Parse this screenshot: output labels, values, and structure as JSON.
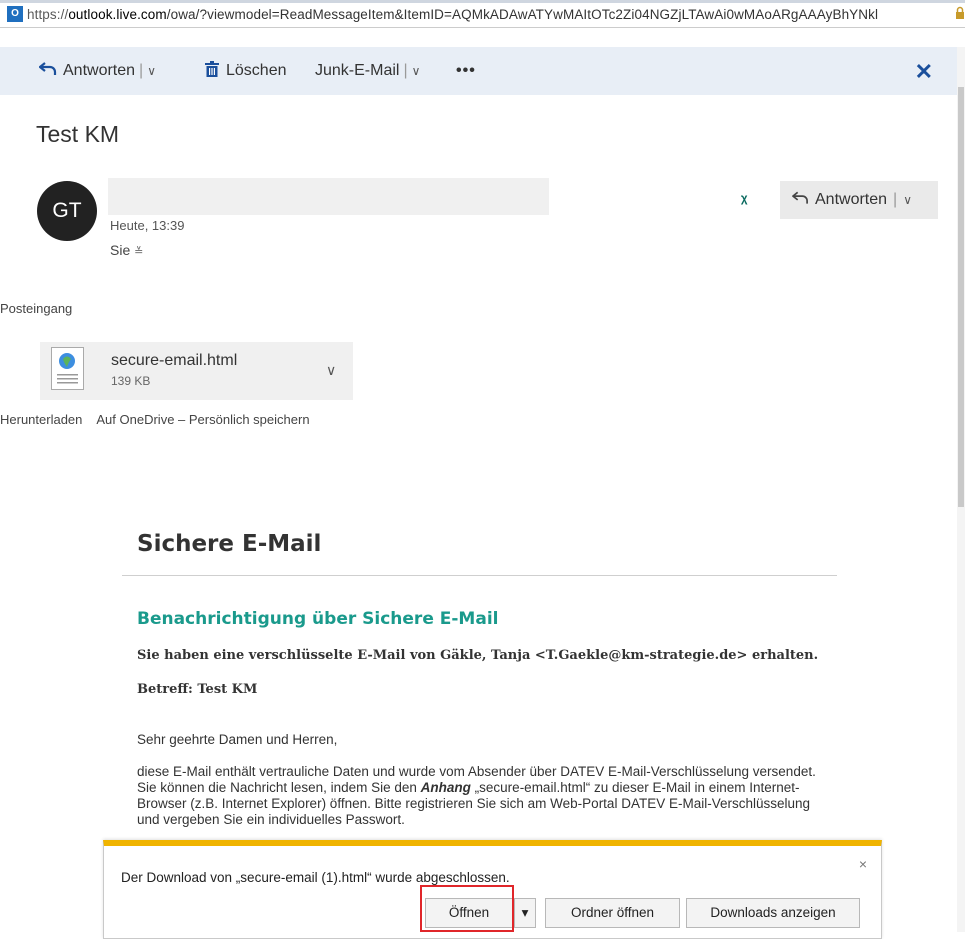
{
  "browser": {
    "url_scheme": "https://",
    "url_host": "outlook.live.com",
    "url_rest": "/owa/?viewmodel=ReadMessageItem&ItemID=AQMkADAwATYwMAItOTc2Zi04NGZjLTAwAi0wMAoARgAAAyBhYNkl"
  },
  "toolbar": {
    "reply_label": "Antworten",
    "delete_label": "Löschen",
    "junk_label": "Junk-E-Mail",
    "more_label": "•••"
  },
  "message": {
    "subject": "Test KM",
    "avatar_initials": "GT",
    "date": "Heute, 13:39",
    "recipient": "Sie",
    "reply_button_label": "Antworten",
    "folder": "Posteingang"
  },
  "attachment": {
    "name": "secure-email.html",
    "size": "139 KB",
    "actions": [
      "Herunterladen",
      "Auf OneDrive – Persönlich speichern"
    ]
  },
  "body": {
    "heading": "Sichere E-Mail",
    "subheading": "Benachrichtigung über Sichere E-Mail",
    "received_line": "Sie haben eine verschlüsselte E-Mail von Gäkle, Tanja <T.Gaekle@km-strategie.de> erhalten.",
    "subject_line": "Betreff: Test KM",
    "salutation": "Sehr geehrte Damen und Herren,",
    "paragraph_1": "diese E-Mail enthält vertrauliche Daten und wurde vom Absender über DATEV E-Mail-Verschlüsselung versendet. Sie können die Nachricht lesen, indem Sie den ",
    "paragraph_em": "Anhang",
    "paragraph_2": " „secure-email.html“ zu dieser E-Mail in einem Internet-Browser (z.B. Internet Explorer) öffnen. Bitte registrieren Sie sich am Web-Portal DATEV E-Mail-Verschlüsselung und vergeben Sie ein individuelles Passwort."
  },
  "download_bar": {
    "message": "Der Download von „secure-email (1).html“ wurde abgeschlossen.",
    "open_label": "Öffnen",
    "dropdown_glyph": "▾",
    "open_folder_label": "Ordner öffnen",
    "show_downloads_label": "Downloads anzeigen",
    "close_glyph": "×"
  },
  "colors": {
    "accent": "#1a9a8c",
    "toolbar_bg": "#e8eef6",
    "download_bar_border": "#f0b400",
    "highlight": "#e0262a"
  }
}
